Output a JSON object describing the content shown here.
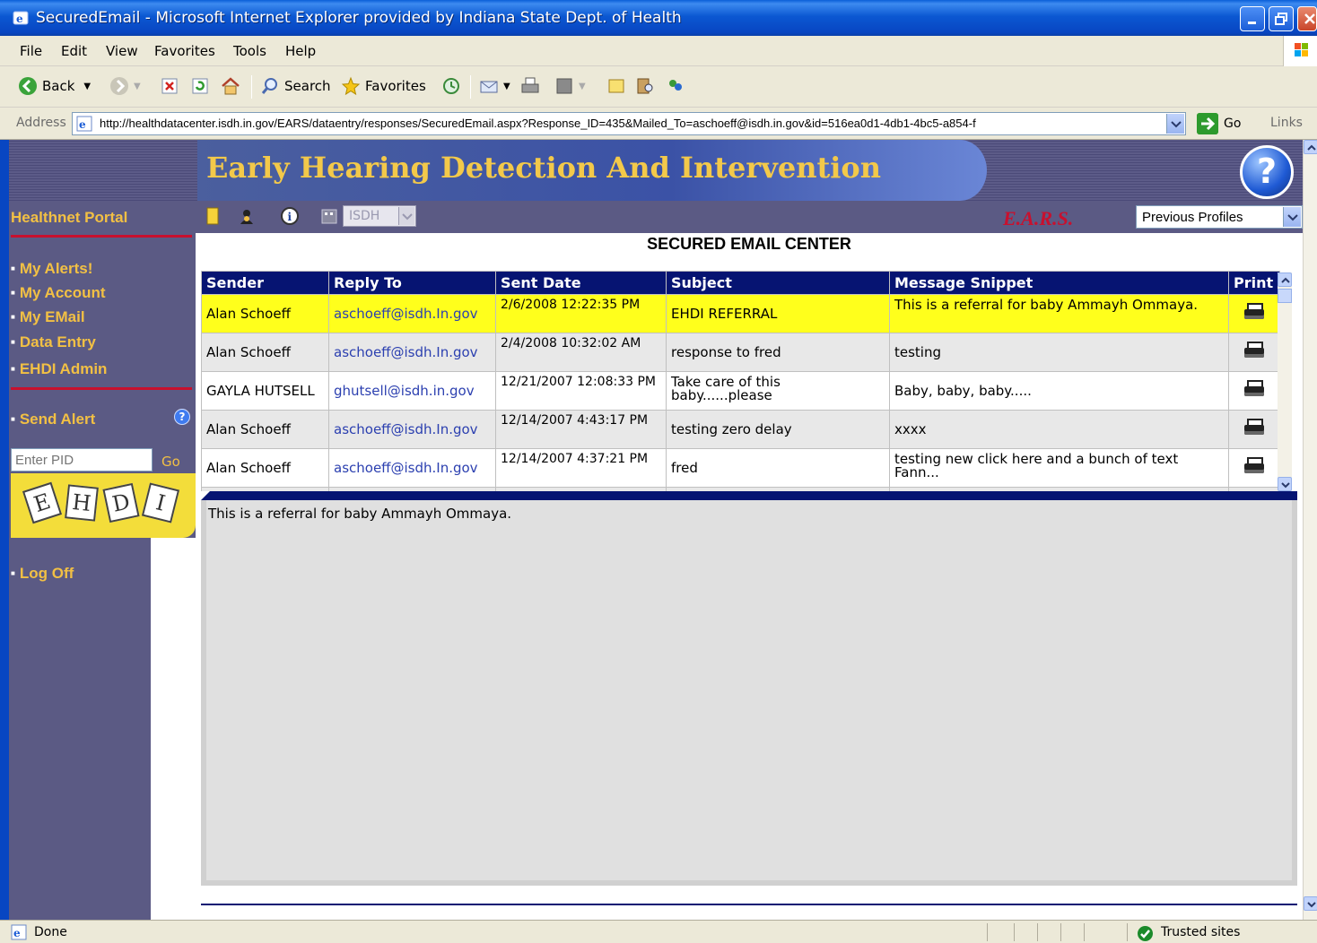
{
  "window": {
    "title": "SecuredEmail - Microsoft Internet Explorer provided by Indiana State Dept. of Health"
  },
  "menu": [
    "File",
    "Edit",
    "View",
    "Favorites",
    "Tools",
    "Help"
  ],
  "toolbar": {
    "back_label": "Back",
    "search_label": "Search",
    "favorites_label": "Favorites"
  },
  "address": {
    "label": "Address",
    "url": "http://healthdatacenter.isdh.in.gov/EARS/dataentry/responses/SecuredEmail.aspx?Response_ID=435&Mailed_To=aschoeff@isdh.in.gov&id=516ea0d1-4db1-4bc5-a854-f",
    "go_label": "Go",
    "links_label": "Links"
  },
  "banner": {
    "title": "Early Hearing Detection And Intervention",
    "help_glyph": "?"
  },
  "navbar": {
    "portal_label": "Healthnet Portal",
    "isdh_select": "ISDH",
    "ears_label": "E.A.R.S.",
    "previous_profiles": "Previous Profiles"
  },
  "sidebar": {
    "links": [
      "My Alerts!",
      "My Account",
      "My EMail",
      "Data Entry",
      "EHDI Admin"
    ],
    "send_alert": "Send Alert",
    "pid_placeholder": "Enter PID",
    "pid_go": "Go",
    "logo_letters": [
      "E",
      "H",
      "D",
      "I"
    ],
    "log_off": "Log Off"
  },
  "main": {
    "title": "SECURED EMAIL CENTER",
    "columns": [
      "Sender",
      "Reply To",
      "Sent Date",
      "Subject",
      "Message Snippet",
      "Print"
    ],
    "rows": [
      {
        "sender": "Alan Schoeff",
        "reply_to": "aschoeff@isdh.In.gov",
        "sent_date": "2/6/2008 12:22:35 PM",
        "subject": "EHDI REFERRAL",
        "snippet": "This is a referral for baby Ammayh Ommaya.",
        "selected": true
      },
      {
        "sender": "Alan Schoeff",
        "reply_to": "aschoeff@isdh.In.gov",
        "sent_date": "2/4/2008 10:32:02 AM",
        "subject": "response to fred",
        "snippet": "testing",
        "selected": false
      },
      {
        "sender": "GAYLA HUTSELL",
        "reply_to": "ghutsell@isdh.in.gov",
        "sent_date": "12/21/2007 12:08:33 PM",
        "subject": "Take care of this baby......please",
        "snippet": "Baby, baby, baby.....",
        "selected": false
      },
      {
        "sender": "Alan Schoeff",
        "reply_to": "aschoeff@isdh.In.gov",
        "sent_date": "12/14/2007 4:43:17 PM",
        "subject": "testing zero delay",
        "snippet": "xxxx",
        "selected": false
      },
      {
        "sender": "Alan Schoeff",
        "reply_to": "aschoeff@isdh.In.gov",
        "sent_date": "12/14/2007 4:37:21 PM",
        "subject": "fred",
        "snippet": "testing new click here and a bunch of text Fann...",
        "selected": false
      }
    ],
    "preview_text": "This is a referral for baby Ammayh Ommaya."
  },
  "status": {
    "text": "Done",
    "zone": "Trusted sites"
  },
  "colors": {
    "titlebar": "#0846c2",
    "sidebar_bg": "#5b5a84",
    "link_gold": "#f2c044",
    "grid_header": "#061472",
    "selected_row": "#ffff1c"
  }
}
